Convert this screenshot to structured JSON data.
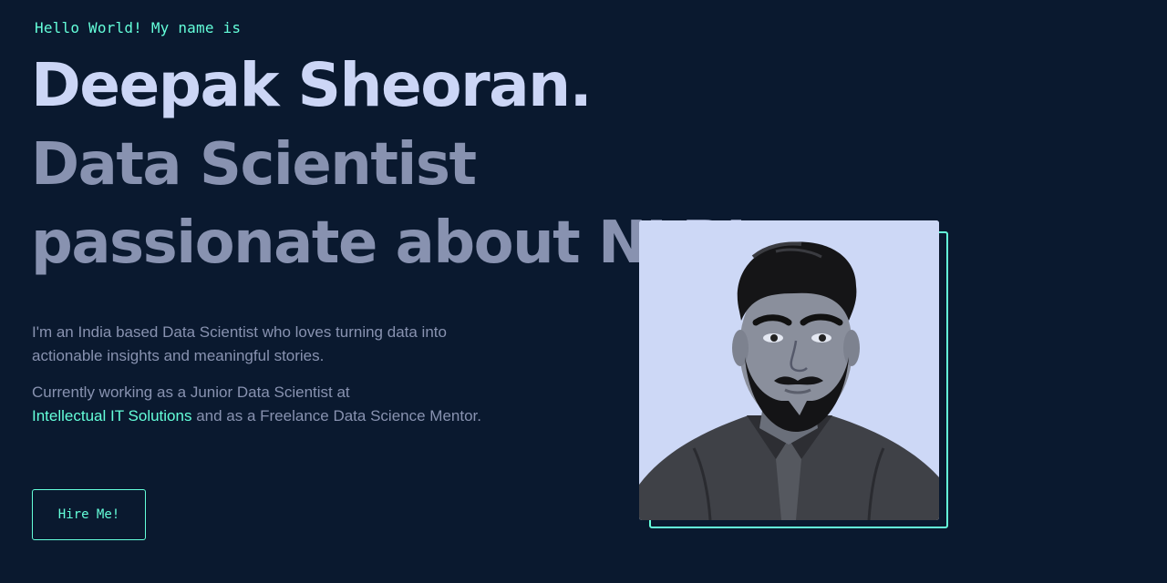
{
  "hero": {
    "greeting": "Hello World! My name is",
    "name": "Deepak Sheoran.",
    "tagline": "Data Scientist passionate about NLP!",
    "bio_line1": "I'm an India based Data Scientist who loves turning data into actionable insights and meaningful stories.",
    "bio_line2_prefix": "Currently working as a Junior Data Scientist at",
    "company_link": "Intellectual IT Solutions",
    "bio_line2_suffix": " and as a Freelance Data Science Mentor.",
    "cta_label": "Hire Me!"
  },
  "colors": {
    "background": "#0a192f",
    "accent": "#64ffda",
    "heading": "#ccd6f6",
    "muted": "#8892b0"
  }
}
